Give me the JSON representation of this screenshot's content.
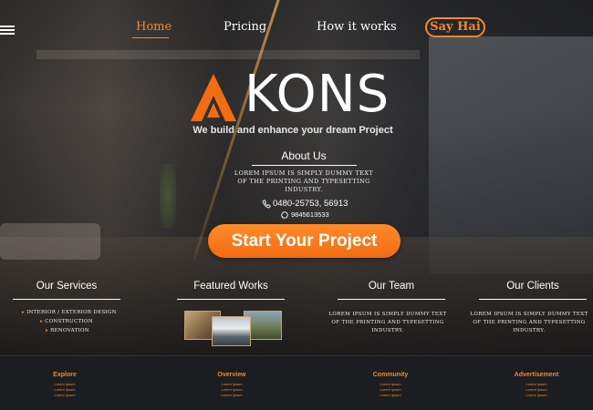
{
  "nav": {
    "home": "Home",
    "pricing": "Pricing",
    "how": "How it works",
    "say_hai": "Say Hai"
  },
  "brand": {
    "name": "KONS",
    "tagline": "We build and enhance your dream Project",
    "accent": "#f28a2e"
  },
  "about": {
    "title": "About Us",
    "text": "Lorem Ipsum is simply dummy text of the printing and typesetting industry.",
    "phone": "0480-25753, 56913",
    "whatsapp": "9845613533"
  },
  "cta": {
    "label": "Start Your Project"
  },
  "sections": {
    "services": {
      "title": "Our Services",
      "items": [
        "Interior / Exterior Design",
        "Construction",
        "Renovation"
      ]
    },
    "works": {
      "title": "Featured Works"
    },
    "team": {
      "title": "Our Team",
      "text": "Lorem Ipsum is simply dummy text of the printing and typesetting industry."
    },
    "clients": {
      "title": "Our Clients",
      "text": "Lorem Ipsum is simply dummy text of the printing and typesetting industry."
    }
  },
  "footer": {
    "columns": [
      {
        "title": "Explore",
        "items": [
          "Lorem ipsum",
          "Lorem ipsum",
          "Lorem ipsum"
        ]
      },
      {
        "title": "Overview",
        "items": [
          "Lorem ipsum",
          "Lorem ipsum",
          "Lorem ipsum"
        ]
      },
      {
        "title": "Community",
        "items": [
          "Lorem ipsum",
          "Lorem ipsum",
          "Lorem ipsum"
        ]
      },
      {
        "title": "Advertisement",
        "items": [
          "Lorem ipsum",
          "Lorem ipsum",
          "Lorem ipsum"
        ]
      }
    ]
  },
  "icons": {
    "menu": "hamburger-menu-icon",
    "phone": "phone-icon",
    "whatsapp": "whatsapp-icon",
    "logo": "logo-a-icon"
  }
}
